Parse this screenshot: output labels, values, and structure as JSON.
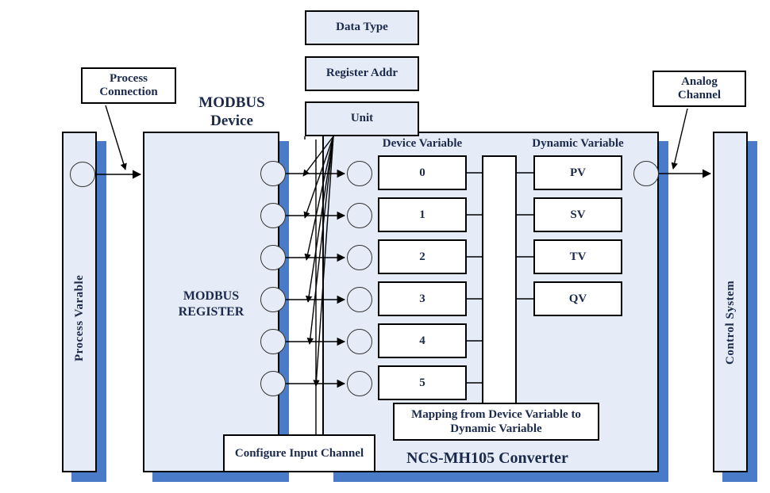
{
  "diagram": {
    "title": "NCS-MH105 Converter MODBUS to HART mapping diagram",
    "colors": {
      "panel_fill": "#e6ecf7",
      "panel_border": "#000000",
      "shadow_blue": "#4a7bc8",
      "text_navy": "#1b2a4a",
      "box_white": "#ffffff"
    }
  },
  "left_panel": {
    "label": "Process Varable"
  },
  "right_panel": {
    "label": "Control System"
  },
  "modbus_device": {
    "title_line1": "MODBUS",
    "title_line2": "Device",
    "register_line1": "MODBUS",
    "register_line2": "REGISTER"
  },
  "converter": {
    "title": "NCS-MH105 Converter",
    "device_variable_heading": "Device Variable",
    "dynamic_variable_heading": "Dynamic Variable",
    "device_variables": [
      "0",
      "1",
      "2",
      "3",
      "4",
      "5"
    ],
    "dynamic_variables": [
      "PV",
      "SV",
      "TV",
      "QV"
    ],
    "mapping_note_line1": "Mapping from Device Variable to",
    "mapping_note_line2": "Dynamic Variable"
  },
  "callouts": {
    "process_connection_line1": "Process",
    "process_connection_line2": "Connection",
    "data_type": "Data Type",
    "register_addr": "Register Addr",
    "unit": "Unit",
    "analog_channel_line1": "Analog",
    "analog_channel_line2": "Channel",
    "configure_input_channel": "Configure Input Channel"
  }
}
